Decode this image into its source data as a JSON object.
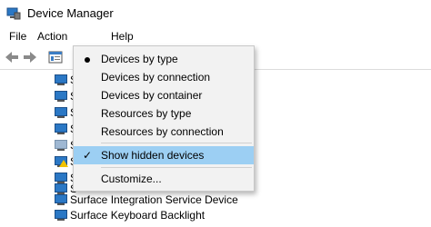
{
  "window": {
    "title": "Device Manager"
  },
  "menubar": {
    "file": "File",
    "action": "Action",
    "help": "Help"
  },
  "tree": {
    "rows": [
      {
        "label": "S",
        "icon": "blue-device-icon"
      },
      {
        "label": "S",
        "icon": "blue-device-icon"
      },
      {
        "label": "S",
        "icon": "blue-device-icon"
      },
      {
        "label": "S",
        "icon": "blue-device-icon"
      },
      {
        "label": "S",
        "icon": "gray-device-icon"
      },
      {
        "label": "S",
        "icon": "warning-device-icon"
      },
      {
        "label": "S",
        "icon": "blue-device-icon"
      },
      {
        "label": "S",
        "icon": "blue-device-icon"
      },
      {
        "label": "Surface Integration Service Device",
        "icon": "blue-device-icon"
      },
      {
        "label": "Surface Keyboard Backlight",
        "icon": "blue-device-icon"
      }
    ]
  },
  "view_menu": {
    "devices_by_type": "Devices by type",
    "devices_by_connection": "Devices by connection",
    "devices_by_container": "Devices by container",
    "resources_by_type": "Resources by type",
    "resources_by_connection": "Resources by connection",
    "show_hidden_devices": "Show hidden devices",
    "customize": "Customize...",
    "checked_glyph": "✓"
  },
  "colors": {
    "highlight": "#9ccff3",
    "menu_bg": "#f2f2f2",
    "device_blue": "#2b78c5"
  }
}
